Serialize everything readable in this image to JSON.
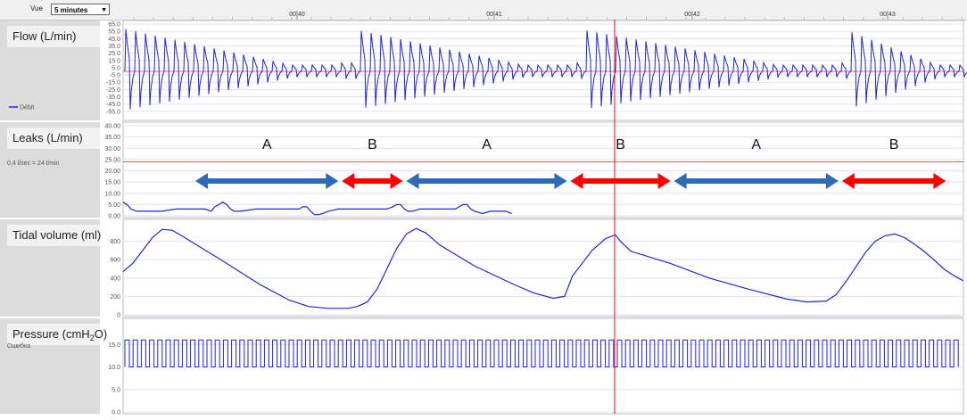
{
  "toolbar": {
    "view_label": "Vue",
    "view_value": "5 minutes"
  },
  "colors": {
    "signal": "#2222dd",
    "marker": "#ff0000",
    "arrow_a": "#2e6ab5",
    "arrow_b": "#ff0000",
    "threshold": "#ff2222",
    "panel_bg": "#e6e6e6",
    "grid": "#dde4ef"
  },
  "chart_data": {
    "type": "line",
    "x_unit": "mm:ss",
    "time_ticks": [
      "00:40",
      "00:41",
      "00:42",
      "00:43"
    ],
    "marker_time": "00:41.6",
    "panels": [
      {
        "key": "flow",
        "title": "Flow (L/min)",
        "legend": "Débit",
        "ylim": [
          -65,
          65
        ],
        "yticks": [
          "65.0",
          "55.0",
          "45.0",
          "35.0",
          "25.0",
          "15.0",
          "5.0",
          "-5.0",
          "-15.0",
          "-25.0",
          "-35.0",
          "-45.0",
          "-55.0"
        ],
        "reference_line": 0
      },
      {
        "key": "leaks",
        "title": "Leaks (L/min)",
        "threshold_label": "0,4 l/sec = 24 l/min",
        "threshold_value": 24,
        "ylim": [
          0,
          40
        ],
        "yticks": [
          "40.00",
          "35.00",
          "30.00",
          "25.00",
          "20.00",
          "15.00",
          "10.00",
          "5.00",
          "0.00"
        ],
        "series_points": [
          [
            0,
            6
          ],
          [
            0.02,
            5
          ],
          [
            0.04,
            3
          ],
          [
            0.07,
            2
          ],
          [
            0.1,
            2
          ],
          [
            0.14,
            2
          ],
          [
            0.2,
            2
          ],
          [
            0.27,
            3
          ],
          [
            0.36,
            3
          ],
          [
            0.42,
            3
          ],
          [
            0.45,
            2
          ],
          [
            0.47,
            4
          ],
          [
            0.49,
            5
          ],
          [
            0.51,
            6
          ],
          [
            0.53,
            5
          ],
          [
            0.55,
            3
          ],
          [
            0.57,
            2
          ],
          [
            0.6,
            2
          ],
          [
            0.68,
            3
          ],
          [
            0.8,
            3
          ],
          [
            0.87,
            3
          ],
          [
            0.9,
            3
          ],
          [
            0.92,
            4
          ],
          [
            0.94,
            4
          ],
          [
            0.96,
            2
          ],
          [
            0.98,
            0.5
          ],
          [
            1.0,
            0.5
          ],
          [
            1.02,
            1
          ],
          [
            1.05,
            2
          ],
          [
            1.1,
            3
          ],
          [
            1.2,
            3
          ],
          [
            1.3,
            3
          ],
          [
            1.35,
            3
          ],
          [
            1.38,
            4
          ],
          [
            1.4,
            5
          ],
          [
            1.42,
            5
          ],
          [
            1.44,
            3
          ],
          [
            1.46,
            2
          ],
          [
            1.48,
            2
          ],
          [
            1.52,
            3
          ],
          [
            1.6,
            3
          ],
          [
            1.66,
            3
          ],
          [
            1.7,
            3
          ],
          [
            1.72,
            4
          ],
          [
            1.74,
            5
          ],
          [
            1.76,
            5
          ],
          [
            1.78,
            3
          ],
          [
            1.8,
            2
          ],
          [
            1.84,
            1
          ],
          [
            1.88,
            2
          ],
          [
            1.92,
            2
          ],
          [
            1.96,
            2
          ],
          [
            1.99,
            1
          ]
        ],
        "segments": [
          {
            "label": "A",
            "start": 0.37,
            "end": 1.12,
            "color": "arrow_a"
          },
          {
            "label": "B",
            "start": 1.12,
            "end": 1.45,
            "color": "arrow_b"
          },
          {
            "label": "A",
            "start": 1.45,
            "end": 2.29,
            "color": "arrow_a"
          },
          {
            "label": "B",
            "start": 2.29,
            "end": 2.82,
            "color": "arrow_b"
          },
          {
            "label": "A",
            "start": 2.82,
            "end": 3.68,
            "color": "arrow_a"
          },
          {
            "label": "B",
            "start": 3.68,
            "end": 4.23,
            "color": "arrow_b"
          }
        ]
      },
      {
        "key": "tidal",
        "title": "Tidal volume (ml)",
        "ylim": [
          0,
          1000
        ],
        "yticks": [
          "800",
          "600",
          "400",
          "200",
          "0"
        ],
        "series_points": [
          [
            0,
            470
          ],
          [
            0.05,
            560
          ],
          [
            0.1,
            700
          ],
          [
            0.15,
            840
          ],
          [
            0.2,
            930
          ],
          [
            0.25,
            920
          ],
          [
            0.3,
            860
          ],
          [
            0.5,
            600
          ],
          [
            0.7,
            330
          ],
          [
            0.85,
            160
          ],
          [
            0.95,
            90
          ],
          [
            1.05,
            70
          ],
          [
            1.15,
            70
          ],
          [
            1.2,
            90
          ],
          [
            1.25,
            140
          ],
          [
            1.3,
            280
          ],
          [
            1.35,
            500
          ],
          [
            1.4,
            720
          ],
          [
            1.45,
            880
          ],
          [
            1.5,
            940
          ],
          [
            1.55,
            890
          ],
          [
            1.62,
            760
          ],
          [
            1.8,
            530
          ],
          [
            2.0,
            330
          ],
          [
            2.1,
            240
          ],
          [
            2.2,
            180
          ],
          [
            2.26,
            200
          ],
          [
            2.3,
            420
          ],
          [
            2.35,
            560
          ],
          [
            2.4,
            700
          ],
          [
            2.47,
            830
          ],
          [
            2.52,
            870
          ],
          [
            2.55,
            790
          ],
          [
            2.6,
            690
          ],
          [
            2.8,
            560
          ],
          [
            3.0,
            400
          ],
          [
            3.2,
            280
          ],
          [
            3.4,
            170
          ],
          [
            3.5,
            140
          ],
          [
            3.6,
            150
          ],
          [
            3.65,
            220
          ],
          [
            3.7,
            360
          ],
          [
            3.75,
            520
          ],
          [
            3.8,
            680
          ],
          [
            3.85,
            800
          ],
          [
            3.9,
            860
          ],
          [
            3.95,
            880
          ],
          [
            4.0,
            840
          ],
          [
            4.05,
            770
          ],
          [
            4.1,
            690
          ],
          [
            4.15,
            600
          ],
          [
            4.2,
            500
          ],
          [
            4.25,
            430
          ],
          [
            4.3,
            370
          ]
        ]
      },
      {
        "key": "pressure",
        "title": "Pressure (cmH2O)",
        "title_main": "Pressure (cmH",
        "title_sub": "2",
        "title_end": "O)",
        "corner_label": "Ошибка",
        "ylim": [
          0,
          20
        ],
        "yticks": [
          "15.0",
          "10.0",
          "5.0",
          "0.0"
        ],
        "high": 16,
        "low": 10
      }
    ]
  }
}
